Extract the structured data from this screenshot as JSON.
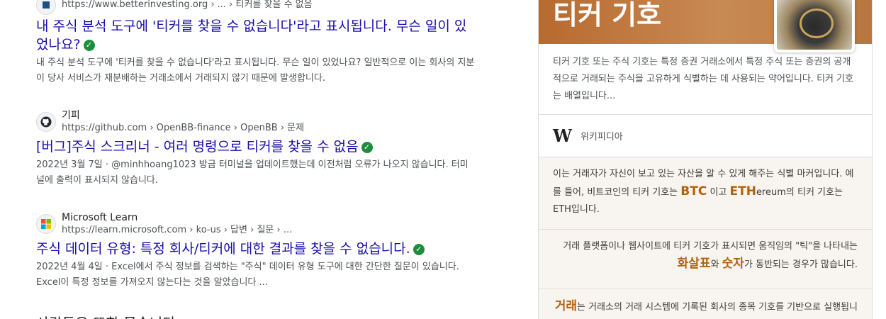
{
  "results": [
    {
      "site_name": "",
      "url": "https://www.betterinvesting.org › ... › 티커를 찾을 수 없음",
      "title": "내 주식 분석 도구에 '티커를 찾을 수 없습니다'라고 표시됩니다. 무슨 일이 있었나요?",
      "snippet": "내 주식 분석 도구에 '티커를 찾을 수 없습니다'라고 표시됩니다. 무슨 일이 있었나요? 일반적으로 이는 회사의 지분이 당사 서비스가 재분배하는 거래소에서 거래되지 않기 때문에 발생합니다.",
      "icon": "betterinvesting-icon"
    },
    {
      "site_name": "기피",
      "url": "https://github.com › OpenBB-finance › OpenBB › 문제",
      "title": "[버그]주식 스크리너 - 여러 명령으로 티커를 찾을 수 없음",
      "snippet": "2022년 3월 7일 · @minhhoang1023 방금 터미널을 업데이트했는데 이전처럼 오류가 나오지 않습니다. 터미널에 출력이 표시되지 않습니다.",
      "icon": "github-icon"
    },
    {
      "site_name": "Microsoft Learn",
      "url": "https://learn.microsoft.com › ko-us › 답변 › 질문 › ...",
      "title": "주식 데이터 유형: 특정 회사/티커에 대한 결과를 찾을 수 없습니다.",
      "snippet": "2022년 4월 4일 · Excel에서 주식 정보를 검색하는 \"주식\" 데이터 유형 도구에 대한 간단한 질문이 있습니다. Excel이 특정 정보를 가져오지 않는다는 것을 알았습니다 ...",
      "icon": "microsoft-icon"
    }
  ],
  "cut_heading": "사람들은 또한 묻습니다",
  "panel": {
    "title": "티커 기호",
    "description": "티커 기호 또는 주식 기호는 특정 증권 거래소에서 특정 주식 또는 증권의 공개적으로 거래되는 주식을 고유하게 식별하는 데 사용되는 약어입니다. 티커 기호는 배열입니다...",
    "source_logo": "W",
    "source_name": "위키피디아",
    "block1": {
      "pre": "이는 거래자가 자신이 보고 있는 자산을 알 수 있게 해주는 식별 마커입니다. 예를 들어, 비트코인의 티커 기호는 ",
      "hl1": "BTC",
      "mid1": " 이고 ",
      "hl2": "ETH",
      "mid2": "ereum의 티커 기호는 ETH입니다."
    },
    "block2": {
      "pre": "거래 플랫폼이나 웹사이트에 티커 기호가 표시되면 움직임의 \"틱\"을 나타내는 ",
      "hl1": "화살표",
      "mid": "와 ",
      "hl2": "숫자",
      "post": "가 동반되는 경우가 많습니다."
    },
    "block3": {
      "hl": "거래",
      "post": "는 거래소의 거래 시스템에 기록된 회사의 종목 기호를 기반으로 실행됩니"
    }
  },
  "colors": {
    "link": "#1a0dab",
    "verified": "#1e8e3e",
    "accent": "#b0620f"
  }
}
